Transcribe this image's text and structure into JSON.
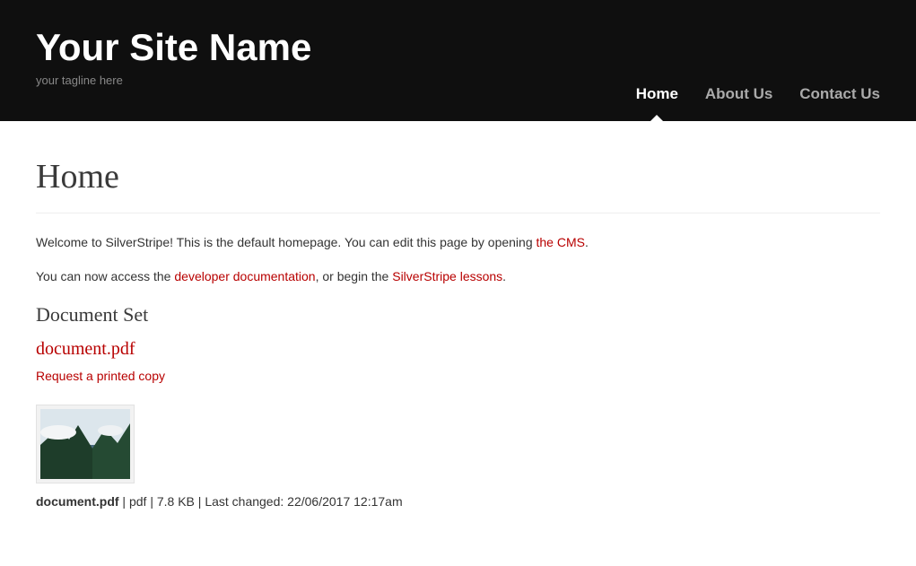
{
  "header": {
    "site_title": "Your Site Name",
    "tagline": "your tagline here"
  },
  "nav": {
    "items": [
      {
        "label": "Home",
        "active": true
      },
      {
        "label": "About Us",
        "active": false
      },
      {
        "label": "Contact Us",
        "active": false
      }
    ]
  },
  "page": {
    "title": "Home",
    "intro_before_link": "Welcome to SilverStripe! This is the default homepage. You can edit this page by opening ",
    "intro_link": "the CMS",
    "intro_after_link": ".",
    "para2_prefix": "You can now access the ",
    "para2_link1": "developer documentation",
    "para2_mid": ", or begin the ",
    "para2_link2": "SilverStripe lessons",
    "para2_suffix": "."
  },
  "document_set": {
    "heading": "Document Set",
    "doc_title": "document.pdf",
    "request_label": "Request a printed copy",
    "meta": {
      "name": "document.pdf",
      "sep1": " | ",
      "type": "pdf",
      "sep2": " | ",
      "size": "7.8 KB",
      "sep3": " | ",
      "changed_label": "Last changed: ",
      "changed_value": "22/06/2017 12:17am"
    }
  }
}
